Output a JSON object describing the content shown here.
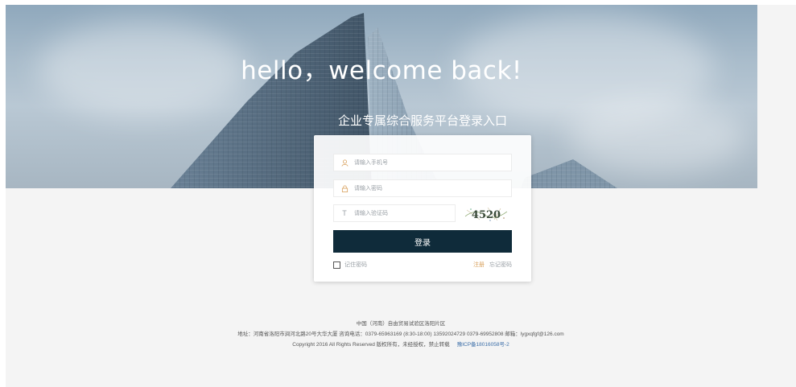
{
  "hero": {
    "headline": "hello，welcome back!",
    "subtitle": "企业专属综合服务平台登录入口"
  },
  "login": {
    "phone_placeholder": "请输入手机号",
    "password_placeholder": "请输入密码",
    "code_placeholder": "请输入验证码",
    "captcha_text": "4520",
    "submit_label": "登录",
    "remember_label": "记住密码",
    "register_label": "注册",
    "forgot_label": "忘记密码",
    "icons": {
      "phone": "user-icon",
      "password": "lock-icon",
      "code": "text-icon"
    }
  },
  "footer": {
    "line1": "中国（河南）自由贸易试验区洛阳片区",
    "line2": "地址：河南省洛阳市涧河北路20号大华大厦  咨询电话：0379-65963169 (8:30-18:00)  13592024729  0379-69952808  邮箱：lygxqfgf@126.com",
    "copyright": "Copyright 2016 All Rights Reserved 版权所有，未经授权，禁止转载",
    "icp": "豫ICP备18016058号-2"
  },
  "colors": {
    "button": "#0f2b3a",
    "accent": "#d9a25f",
    "page_bg": "#f4f4f4"
  }
}
